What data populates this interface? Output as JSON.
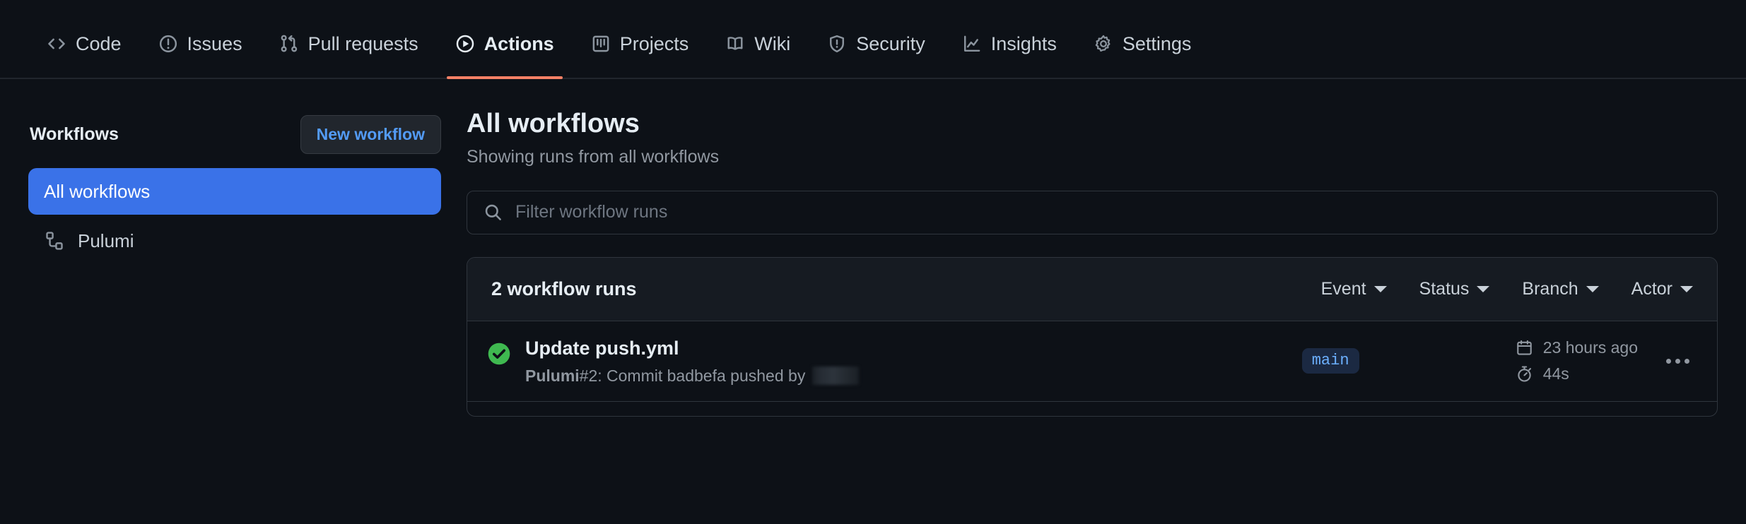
{
  "repo_nav": {
    "items": [
      {
        "label": "Code",
        "icon": "code-icon",
        "active": false
      },
      {
        "label": "Issues",
        "icon": "issue-opened-icon",
        "active": false
      },
      {
        "label": "Pull requests",
        "icon": "git-pull-request-icon",
        "active": false
      },
      {
        "label": "Actions",
        "icon": "play-icon",
        "active": true
      },
      {
        "label": "Projects",
        "icon": "project-icon",
        "active": false
      },
      {
        "label": "Wiki",
        "icon": "book-icon",
        "active": false
      },
      {
        "label": "Security",
        "icon": "shield-icon",
        "active": false
      },
      {
        "label": "Insights",
        "icon": "graph-icon",
        "active": false
      },
      {
        "label": "Settings",
        "icon": "gear-icon",
        "active": false
      }
    ],
    "active_underline_color": "#f78166"
  },
  "sidebar": {
    "title": "Workflows",
    "new_workflow_label": "New workflow",
    "items": [
      {
        "label": "All workflows",
        "icon": null,
        "selected": true
      },
      {
        "label": "Pulumi",
        "icon": "workflow-icon",
        "selected": false
      }
    ],
    "selected_color": "#3a72e8"
  },
  "main": {
    "title": "All workflows",
    "subtitle": "Showing runs from all workflows",
    "filter": {
      "icon": "search-icon",
      "placeholder": "Filter workflow runs",
      "value": ""
    },
    "runs_panel": {
      "count_label": "2 workflow runs",
      "filters": [
        {
          "label": "Event",
          "icon": "chevron-down-icon"
        },
        {
          "label": "Status",
          "icon": "chevron-down-icon"
        },
        {
          "label": "Branch",
          "icon": "chevron-down-icon"
        },
        {
          "label": "Actor",
          "icon": "chevron-down-icon"
        }
      ],
      "runs": [
        {
          "status": "success",
          "status_icon": "check-circle-icon",
          "status_color": "#3fb950",
          "title": "Update push.yml",
          "workflow_name": "Pulumi",
          "meta_rest": " #2: Commit badbefa pushed by ",
          "actor_redacted": true,
          "branch": "main",
          "date_icon": "calendar-icon",
          "date": "23 hours ago",
          "duration_icon": "stopwatch-icon",
          "duration": "44s",
          "menu_icon": "kebab-horizontal-icon"
        }
      ]
    }
  }
}
